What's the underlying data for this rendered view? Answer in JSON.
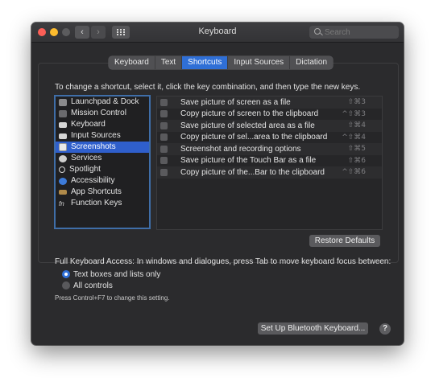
{
  "window": {
    "title": "Keyboard",
    "search_placeholder": "Search",
    "nav_back": "‹",
    "nav_forward": "›"
  },
  "tabs": [
    {
      "label": "Keyboard",
      "active": false
    },
    {
      "label": "Text",
      "active": false
    },
    {
      "label": "Shortcuts",
      "active": true
    },
    {
      "label": "Input Sources",
      "active": false
    },
    {
      "label": "Dictation",
      "active": false
    }
  ],
  "instructions": "To change a shortcut, select it, click the key combination, and then type the new keys.",
  "categories": [
    {
      "label": "Launchpad & Dock",
      "icon": "launchpad-icon",
      "selected": false
    },
    {
      "label": "Mission Control",
      "icon": "mission-control-icon",
      "selected": false
    },
    {
      "label": "Keyboard",
      "icon": "keyboard-icon",
      "selected": false
    },
    {
      "label": "Input Sources",
      "icon": "input-sources-icon",
      "selected": false
    },
    {
      "label": "Screenshots",
      "icon": "screenshots-icon",
      "selected": true
    },
    {
      "label": "Services",
      "icon": "services-gear-icon",
      "selected": false
    },
    {
      "label": "Spotlight",
      "icon": "spotlight-icon",
      "selected": false
    },
    {
      "label": "Accessibility",
      "icon": "accessibility-icon",
      "selected": false
    },
    {
      "label": "App Shortcuts",
      "icon": "app-shortcuts-icon",
      "selected": false
    },
    {
      "label": "Function Keys",
      "icon": "function-keys-icon",
      "selected": false
    }
  ],
  "shortcuts": [
    {
      "label": "Save picture of screen as a file",
      "key": "⇧⌘3"
    },
    {
      "label": "Copy picture of screen to the clipboard",
      "key": "^⇧⌘3"
    },
    {
      "label": "Save picture of selected area as a file",
      "key": "⇧⌘4"
    },
    {
      "label": "Copy picture of sel...area to the clipboard",
      "key": "^⇧⌘4"
    },
    {
      "label": "Screenshot and recording options",
      "key": "⇧⌘5"
    },
    {
      "label": "Save picture of the Touch Bar as a file",
      "key": "⇧⌘6"
    },
    {
      "label": "Copy picture of the...Bar to the clipboard",
      "key": "^⇧⌘6"
    }
  ],
  "restore_defaults": "Restore Defaults",
  "full_keyboard_access": "Full Keyboard Access: In windows and dialogues, press Tab to move keyboard focus between:",
  "radio_options": [
    {
      "label": "Text boxes and lists only",
      "selected": true
    },
    {
      "label": "All controls",
      "selected": false
    }
  ],
  "hint": "Press Control+F7 to change this setting.",
  "bluetooth_button": "Set Up Bluetooth Keyboard...",
  "help_label": "?",
  "colors": {
    "accent": "#2f6fd6",
    "selection": "#2f5fcc",
    "window_bg": "#2b2b2d"
  }
}
